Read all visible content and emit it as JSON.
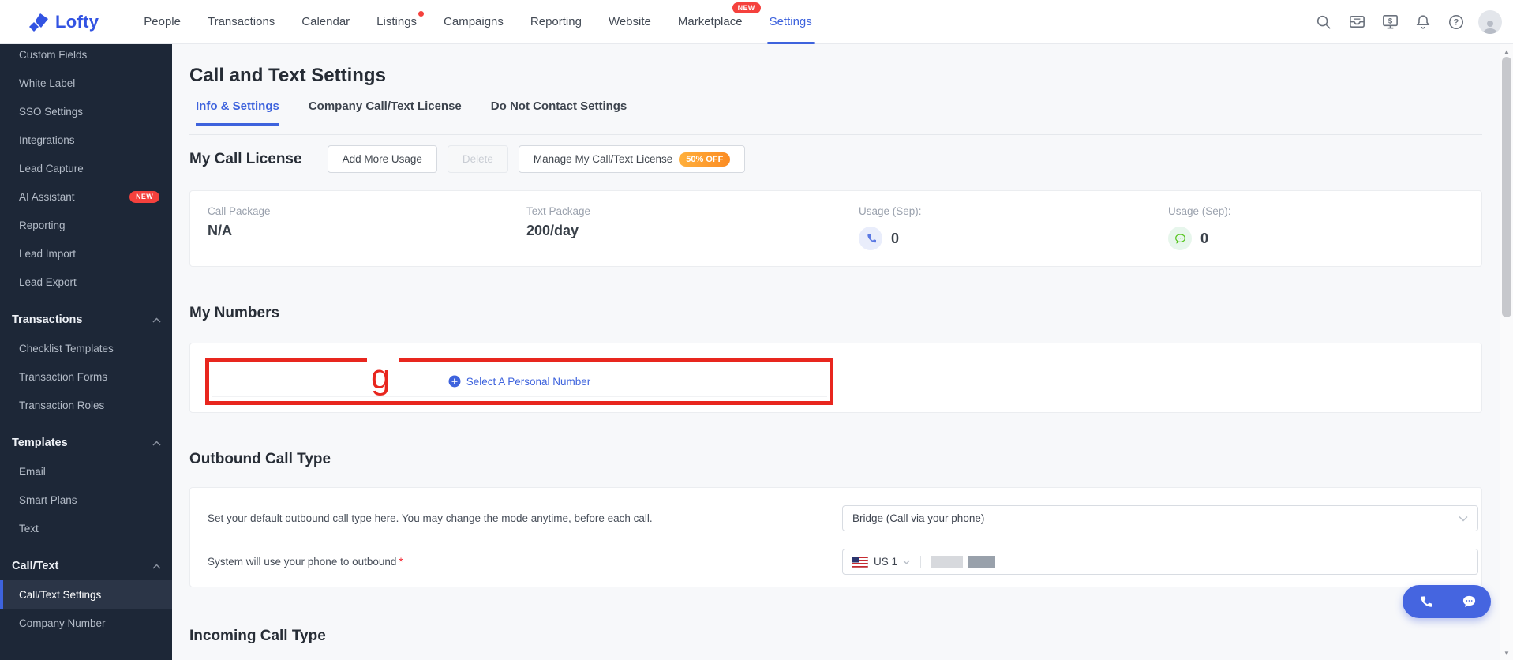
{
  "nav": {
    "brand": "Lofty",
    "items": [
      {
        "label": "People"
      },
      {
        "label": "Transactions"
      },
      {
        "label": "Calendar"
      },
      {
        "label": "Listings",
        "dot": true
      },
      {
        "label": "Campaigns"
      },
      {
        "label": "Reporting"
      },
      {
        "label": "Website"
      },
      {
        "label": "Marketplace",
        "badge": "NEW"
      },
      {
        "label": "Settings",
        "active": true
      }
    ]
  },
  "sidebar": {
    "items": [
      {
        "label": "Custom Fields"
      },
      {
        "label": "White Label"
      },
      {
        "label": "SSO Settings"
      },
      {
        "label": "Integrations"
      },
      {
        "label": "Lead Capture"
      },
      {
        "label": "AI Assistant",
        "badge": "NEW"
      },
      {
        "label": "Reporting"
      },
      {
        "label": "Lead Import"
      },
      {
        "label": "Lead Export"
      },
      {
        "label": "Transactions",
        "type": "section"
      },
      {
        "label": "Checklist Templates"
      },
      {
        "label": "Transaction Forms"
      },
      {
        "label": "Transaction Roles"
      },
      {
        "label": "Templates",
        "type": "section"
      },
      {
        "label": "Email"
      },
      {
        "label": "Smart Plans"
      },
      {
        "label": "Text"
      },
      {
        "label": "Call/Text",
        "type": "section"
      },
      {
        "label": "Call/Text Settings",
        "active": true
      },
      {
        "label": "Company Number"
      }
    ]
  },
  "main": {
    "title": "Call and Text Settings",
    "tabs": [
      {
        "label": "Info & Settings",
        "active": true
      },
      {
        "label": "Company Call/Text License"
      },
      {
        "label": "Do Not Contact Settings"
      }
    ],
    "license": {
      "heading": "My Call License",
      "add_button": "Add More Usage",
      "delete_button": "Delete",
      "manage_button": "Manage My Call/Text License",
      "discount_badge": "50% OFF",
      "fields": [
        {
          "label": "Call Package",
          "value": "N/A"
        },
        {
          "label": "Text Package",
          "value": "200/day"
        },
        {
          "label": "Usage (Sep):",
          "value": "0",
          "icon": "phone-usage-icon"
        },
        {
          "label": "Usage (Sep):",
          "value": "0",
          "icon": "text-usage-icon"
        }
      ]
    },
    "numbers": {
      "heading": "My Numbers",
      "select_link": "Select A Personal Number",
      "annotation": "g"
    },
    "outbound": {
      "heading": "Outbound Call Type",
      "rows": [
        {
          "label": "Set your default outbound call type here. You may change the mode anytime, before each call.",
          "value": "Bridge (Call via your phone)"
        },
        {
          "label": "System will use your phone to outbound",
          "required": "*",
          "country": "US 1"
        }
      ]
    },
    "incoming": {
      "heading": "Incoming Call Type"
    }
  },
  "colors": {
    "accent": "#3e63dd",
    "sidebar_bg": "#1d2737",
    "annotation_red": "#e8261e",
    "badge_red": "#f5413d",
    "discount_orange": "#fb8b22",
    "usage_call": "#5b79e3",
    "usage_text": "#52c41a"
  }
}
